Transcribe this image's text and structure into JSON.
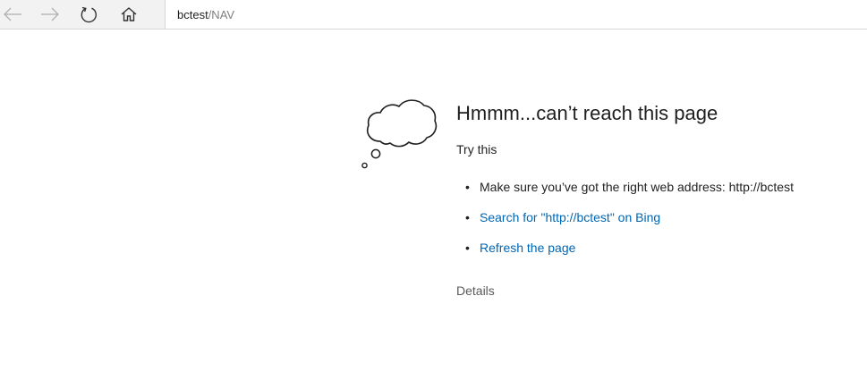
{
  "toolbar": {
    "back_icon": "arrow-left-icon",
    "forward_icon": "arrow-right-icon",
    "refresh_icon": "refresh-icon",
    "home_icon": "home-icon",
    "address": {
      "host": "bctest",
      "path": "/NAV"
    }
  },
  "error": {
    "icon": "thought-cloud-icon",
    "title": "Hmmm...can’t reach this page",
    "subtitle": "Try this",
    "suggestions": [
      {
        "text": "Make sure you’ve got the right web address: http://bctest"
      },
      {
        "text": "Search for \"http://bctest\" on Bing"
      },
      {
        "text": "Refresh the page"
      }
    ],
    "details_label": "Details"
  },
  "colors": {
    "link": "#0066b4",
    "text": "#1f1f1f",
    "muted": "#5a5a5a",
    "toolbar_bg": "#f2f2f2"
  }
}
